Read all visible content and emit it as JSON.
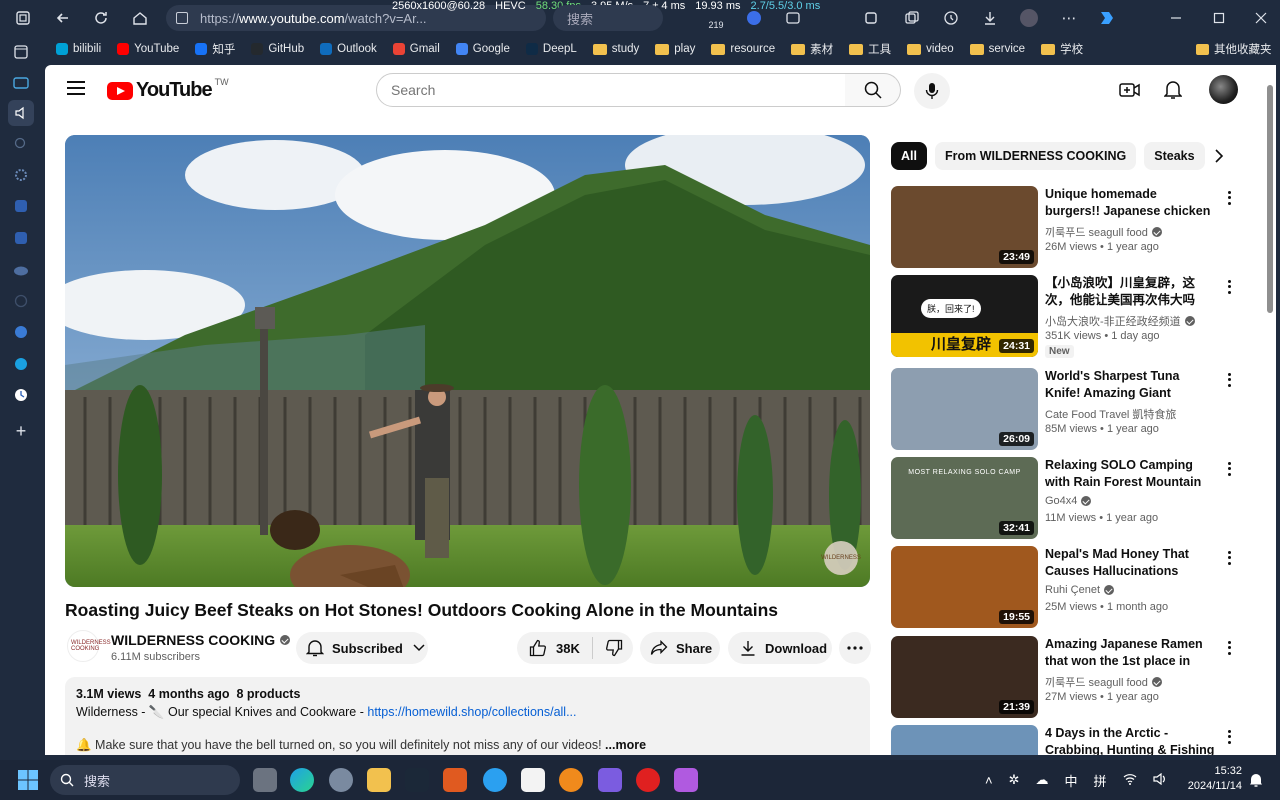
{
  "browser": {
    "url_prefix": "https://",
    "url_host": "www.youtube.com",
    "url_rest": "/watch?v=Ar...",
    "search_placeholder": "搜索",
    "badge_count": "219"
  },
  "osd": {
    "resolution": "2560x1600@60.28",
    "codec": "HEVC",
    "fps": "58.30 fps",
    "bitrate": "3.95 M/s",
    "latency": "7 ± 4 ms",
    "decode": "19.93 ms",
    "bandwidth": "2.7/5.5/3.0 ms"
  },
  "bookmarks": [
    {
      "label": "bilibili",
      "icon": "bilibili-icon",
      "color": "#00a1d6"
    },
    {
      "label": "YouTube",
      "icon": "youtube-icon",
      "color": "#ff0000"
    },
    {
      "label": "知乎",
      "icon": "zhihu-icon",
      "color": "#1772f6"
    },
    {
      "label": "GitHub",
      "icon": "github-icon",
      "color": "#24292e"
    },
    {
      "label": "Outlook",
      "icon": "outlook-icon",
      "color": "#0f6cbd"
    },
    {
      "label": "Gmail",
      "icon": "gmail-icon",
      "color": "#ea4335"
    },
    {
      "label": "Google",
      "icon": "google-icon",
      "color": "#4285f4"
    },
    {
      "label": "DeepL",
      "icon": "deepl-icon",
      "color": "#0f2b46"
    },
    {
      "label": "study",
      "icon": "folder-icon",
      "color": "#f2c14e"
    },
    {
      "label": "play",
      "icon": "folder-icon",
      "color": "#f2c14e"
    },
    {
      "label": "resource",
      "icon": "folder-icon",
      "color": "#f2c14e"
    },
    {
      "label": "素材",
      "icon": "folder-icon",
      "color": "#f2c14e"
    },
    {
      "label": "工具",
      "icon": "folder-icon",
      "color": "#f2c14e"
    },
    {
      "label": "video",
      "icon": "folder-icon",
      "color": "#f2c14e"
    },
    {
      "label": "service",
      "icon": "folder-icon",
      "color": "#f2c14e"
    },
    {
      "label": "学校",
      "icon": "folder-icon",
      "color": "#f2c14e"
    }
  ],
  "bookmarks_other": "其他收藏夹",
  "youtube": {
    "logo_text": "YouTube",
    "region": "TW",
    "search_placeholder": "Search"
  },
  "video": {
    "title": "Roasting Juicy Beef Steaks on Hot Stones! Outdoors Cooking Alone in the Mountains",
    "channel": "WILDERNESS COOKING",
    "channel_avatar_text": "WILDERNESS COOKING",
    "subscribers": "6.11M subscribers",
    "subscribed_label": "Subscribed",
    "likes": "38K",
    "share_label": "Share",
    "download_label": "Download",
    "description": {
      "views": "3.1M views",
      "age": "4 months ago",
      "products": "8 products",
      "line1_prefix": "Wilderness - 🔪 Our special Knives and Cookware - ",
      "line1_link": "https://homewild.shop/collections/all...",
      "line2": "🔔 Make sure that you have the bell turned on, so you will definitely not miss any of our videos!",
      "more": "...more"
    }
  },
  "chips": [
    "All",
    "From WILDERNESS COOKING",
    "Steaks"
  ],
  "recommendations": [
    {
      "title": "Unique homemade burgers!! Japanese chicken burger & fish burger",
      "channel": "끼룩푸드 seagull food",
      "verified": true,
      "views": "26M views",
      "age": "1 year ago",
      "duration": "23:49",
      "badge": "",
      "thumb_color": "#6b4a2e"
    },
    {
      "title": "【小岛浪吹】川皇复辟，这次，他能让美国再次伟大吗",
      "channel": "小岛大浪吹-非正经政经频道",
      "verified": true,
      "views": "351K views",
      "age": "1 day ago",
      "duration": "24:31",
      "badge": "New",
      "thumb_color": "#1a1a1a",
      "thumb_caption": "川皇复辟",
      "thumb_bubble": "朕，回来了!"
    },
    {
      "title": "World's Sharpest Tuna Knife! Amazing Giant bluefin tuna cutting",
      "channel": "Cate Food Travel 凱特食旅",
      "verified": false,
      "views": "85M views",
      "age": "1 year ago",
      "duration": "26:09",
      "badge": "",
      "thumb_color": "#8d9eb0"
    },
    {
      "title": "Relaxing SOLO Camping with Rain Forest Mountain views [...]",
      "channel": "Go4x4",
      "verified": true,
      "views": "11M views",
      "age": "1 year ago",
      "duration": "32:41",
      "badge": "",
      "thumb_color": "#5d6b55",
      "thumb_caption": "MOST RELAXING SOLO CAMP"
    },
    {
      "title": "Nepal's Mad Honey That Causes Hallucinations (They climb to get it)",
      "channel": "Ruhi Çenet",
      "verified": true,
      "views": "25M views",
      "age": "1 month ago",
      "duration": "19:55",
      "badge": "",
      "thumb_color": "#a0581e"
    },
    {
      "title": "Amazing Japanese Ramen that won the 1st place in Japan - Korean style",
      "channel": "끼룩푸드 seagull food",
      "verified": true,
      "views": "27M views",
      "age": "1 year ago",
      "duration": "21:39",
      "badge": "",
      "thumb_color": "#3b2a20"
    },
    {
      "title": "4 Days in the Arctic - Crabbing, Hunting & Fishing Alaska",
      "channel": "",
      "verified": false,
      "views": "",
      "age": "",
      "duration": "",
      "badge": "",
      "thumb_color": "#6d93b8"
    }
  ],
  "taskbar": {
    "search_label": "搜索",
    "ime_lang": "中",
    "ime_mode": "拼",
    "time": "15:32",
    "date": "2024/11/14"
  }
}
